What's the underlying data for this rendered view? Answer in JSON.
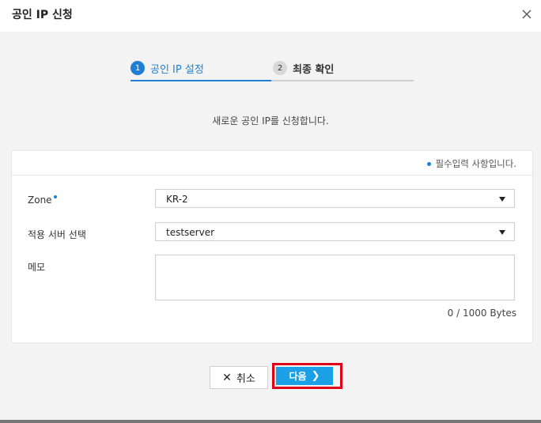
{
  "dialog": {
    "title": "공인 IP 신청"
  },
  "steps": [
    {
      "num": "1",
      "label": "공인 IP 설정"
    },
    {
      "num": "2",
      "label": "최종 확인"
    }
  ],
  "description": "새로운 공인 IP를 신청합니다.",
  "required_note": "필수입력 사항입니다.",
  "form": {
    "zone_label": "Zone",
    "zone_value": "KR-2",
    "server_label": "적용 서버 선택",
    "server_value": "testserver",
    "memo_label": "메모",
    "memo_value": "",
    "bytes_counter": "0 / 1000 Bytes"
  },
  "buttons": {
    "cancel": "취소",
    "next": "다음"
  },
  "colors": {
    "accent": "#1f7fd3",
    "next_button": "#1aa0e6",
    "highlight_border": "#e0001a"
  }
}
